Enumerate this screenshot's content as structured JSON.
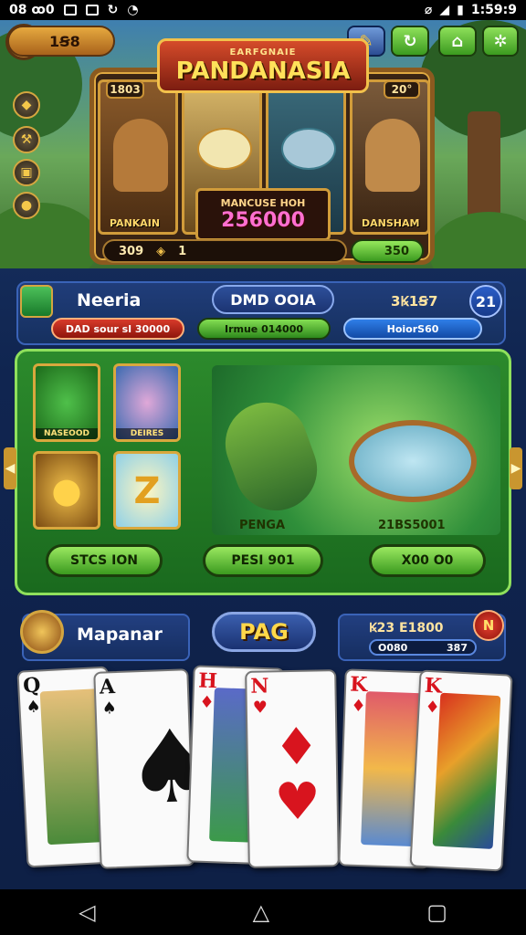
{
  "status": {
    "time_left": "08 ꝏ0",
    "time_right": "1:59:9"
  },
  "top": {
    "coins": "1Ꞩ8",
    "title_sub": "EARFGNAIE",
    "title_main": "PANDANASIA",
    "left_badge": "1803",
    "right_badge": "20°",
    "left_char": "PANKAIN",
    "right_char": "DANSHAM",
    "jackpot_label": "MANCUSE HOH",
    "jackpot_value": "256000",
    "bar_left": "309",
    "bar_mid": "1",
    "bar_right": "350"
  },
  "stats": {
    "title": "Neeria",
    "center": "DMD OOIA",
    "right": "3Ꝃ1Ꞩ7",
    "level": "21",
    "pill_red": "DAD sour sl 30000",
    "pill_green": "Irmue 014000",
    "pill_blue": "HoiorS60"
  },
  "game": {
    "tiles": [
      {
        "label": "NASEOOD"
      },
      {
        "label": "DEIRES"
      },
      {
        "label": ""
      },
      {
        "label": ""
      }
    ],
    "stage_left_label": "PENGA",
    "stage_right_label": "21BS5001",
    "btn_left": "STCS ION",
    "btn_mid": "PESI 901",
    "btn_right": "X00 O0"
  },
  "lower": {
    "left_label": "Mapanar",
    "center_button": "PAG",
    "right_top": "Ꝃ23 E1800",
    "right_bar_left": "O080",
    "right_bar_right": "387",
    "coin_letter": "N"
  },
  "cards": [
    {
      "rank": "Q",
      "suit": "♠",
      "color": "black"
    },
    {
      "rank": "A",
      "suit": "♠",
      "color": "black"
    },
    {
      "rank": "H",
      "suit": "♦",
      "color": "red"
    },
    {
      "rank": "N",
      "suit": "♥",
      "color": "red"
    },
    {
      "rank": "K",
      "suit": "♦",
      "color": "red"
    },
    {
      "rank": "K",
      "suit": "♦",
      "color": "red"
    }
  ],
  "nav": {
    "back": "◁",
    "home": "△",
    "recents": "▢"
  }
}
